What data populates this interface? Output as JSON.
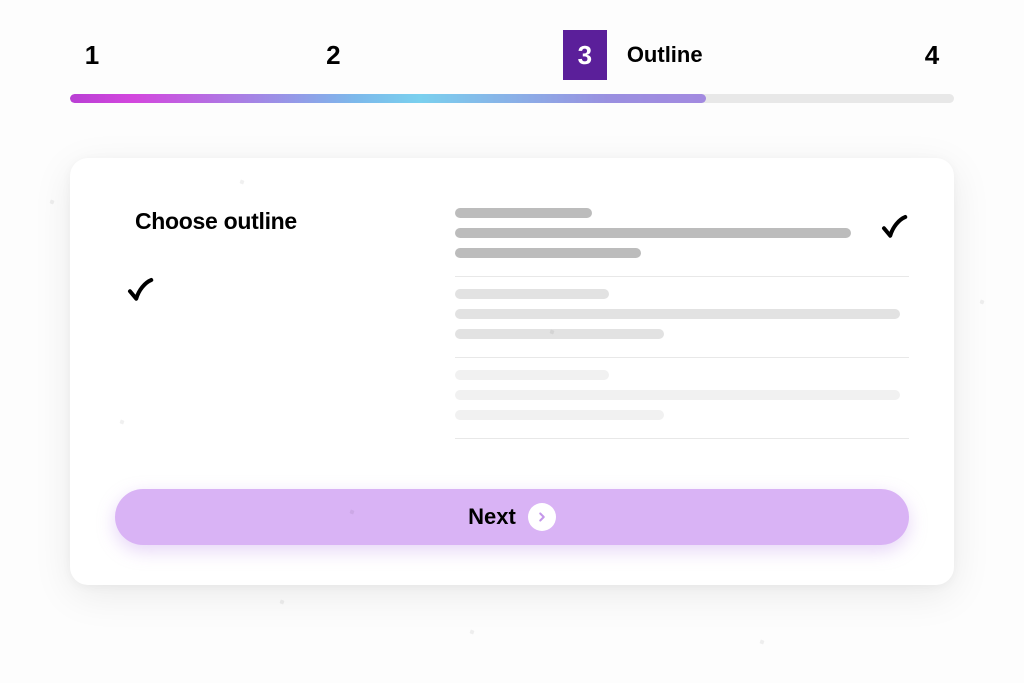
{
  "stepper": {
    "steps": [
      {
        "number": "1",
        "label": ""
      },
      {
        "number": "2",
        "label": ""
      },
      {
        "number": "3",
        "label": "Outline"
      },
      {
        "number": "4",
        "label": ""
      }
    ],
    "active_index": 2,
    "progress_percent": 72
  },
  "card": {
    "title": "Choose outline",
    "next_label": "Next"
  }
}
